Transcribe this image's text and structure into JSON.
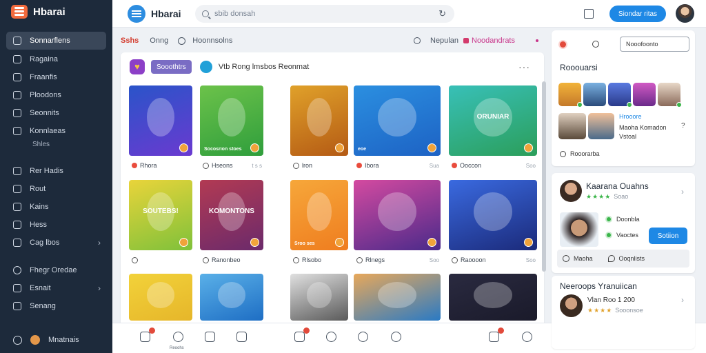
{
  "sidebar": {
    "brand": "Hbarai",
    "items": [
      {
        "label": "Sonnarflens",
        "sub": ""
      },
      {
        "label": "Ragaina",
        "sub": ""
      },
      {
        "label": "Fraanfis",
        "sub": ""
      },
      {
        "label": "Ploodons",
        "sub": ""
      },
      {
        "label": "Seonnits",
        "sub": ""
      },
      {
        "label": "Konnlaeas",
        "sub": "Shles"
      },
      {
        "label": "Rer Hadis",
        "sub": ""
      },
      {
        "label": "Rout",
        "sub": ""
      },
      {
        "label": "Kains",
        "sub": ""
      },
      {
        "label": "Hess",
        "sub": ""
      },
      {
        "label": "Cag lbos",
        "sub": ""
      },
      {
        "label": "Fhegr Oredae",
        "sub": ""
      },
      {
        "label": "Esnait",
        "sub": ""
      },
      {
        "label": "Senang",
        "sub": ""
      }
    ],
    "bottom_label": "Mnatnais"
  },
  "topbar": {
    "title": "Hbarai",
    "search_placeholder": "sbib donsah",
    "button_label": "Siondar ritas"
  },
  "filters": {
    "active": "Sshs",
    "one": "Onng",
    "two": "Hoonnsolns",
    "three": "Nepulan",
    "four": "Noodandrats"
  },
  "feed": {
    "pill": "Sooothtrs",
    "title": "Vtb Rong lmsbos Reonmat",
    "tiles": [
      {
        "caption": "",
        "big": "",
        "meta": "Rhora",
        "sub": "",
        "colors": [
          "#2a54c9",
          "#6a3ad0"
        ]
      },
      {
        "caption": "Socosrion stoes",
        "big": "",
        "meta": "Hseons",
        "sub": "t s s",
        "colors": [
          "#6cc24a",
          "#2f9e3c"
        ]
      },
      {
        "caption": "",
        "big": "",
        "meta": "lron",
        "sub": "",
        "colors": [
          "#e0a12a",
          "#b45a14"
        ]
      },
      {
        "caption": "eoe",
        "big": "",
        "meta": "Ibora",
        "sub": "Sua",
        "colors": [
          "#2b8fe0",
          "#1d62c4"
        ]
      },
      {
        "caption": "",
        "big": "ORUNIAR",
        "meta": "Ooccon",
        "sub": "Soo",
        "colors": [
          "#38c0b8",
          "#2b9e5a"
        ]
      },
      {
        "caption": "",
        "big": "SOUTEBS!",
        "meta": "",
        "sub": "",
        "colors": [
          "#e9d43a",
          "#7fc13a"
        ]
      },
      {
        "caption": "",
        "big": "KOMONTONS",
        "meta": "Ranonbeo",
        "sub": "",
        "colors": [
          "#b23a53",
          "#6b2a6b"
        ]
      },
      {
        "caption": "Sroo ses",
        "big": "",
        "meta": "Rlsobo",
        "sub": "",
        "colors": [
          "#f6a73a",
          "#ef7d1f"
        ]
      },
      {
        "caption": "",
        "big": "",
        "meta": "Rlnegs",
        "sub": "Soo",
        "colors": [
          "#d44aa0",
          "#4a2a8a"
        ]
      },
      {
        "caption": "",
        "big": "",
        "meta": "Raoooon",
        "sub": "Soo",
        "colors": [
          "#3a6ae0",
          "#1b2a7a"
        ]
      },
      {
        "caption": "",
        "big": "",
        "meta": "",
        "sub": "",
        "colors": [
          "#f2d23a",
          "#e6b62a"
        ]
      },
      {
        "caption": "",
        "big": "",
        "meta": "",
        "sub": "",
        "colors": [
          "#5ab0e8",
          "#1e6ec4"
        ]
      },
      {
        "caption": "",
        "big": "",
        "meta": "",
        "sub": "",
        "colors": [
          "#e0e0e0",
          "#5a5a5a"
        ]
      },
      {
        "caption": "",
        "big": "",
        "meta": "",
        "sub": "",
        "colors": [
          "#e8a85a",
          "#2a7ac4"
        ]
      },
      {
        "caption": "",
        "big": "",
        "meta": "",
        "sub": "",
        "colors": [
          "#2a2a40",
          "#1a1a2a"
        ]
      }
    ]
  },
  "bottombar": {
    "label": "Reoohs",
    "primary": "BA"
  },
  "right": {
    "input_label": "Nooofoonto",
    "title": "Rooouarsi",
    "n1": "Hrooore",
    "n2": "Maoha Komadon",
    "n3": "Vstoal",
    "footer": "Rooorarba",
    "profile1": {
      "name": "Kaarana Ouahns",
      "stars": "★★★★",
      "small": "Soao",
      "opt1": "Doonbla",
      "opt2": "Vaoctes",
      "btn": "Sotiion",
      "foot_a": "Maoha",
      "foot_b": "Ooqnlists"
    },
    "profile2": {
      "title": "Neeroops Yranuiican",
      "name": "Vlan Roo 1 200",
      "stars": "★★★★",
      "small": "Sooonsoe"
    }
  }
}
